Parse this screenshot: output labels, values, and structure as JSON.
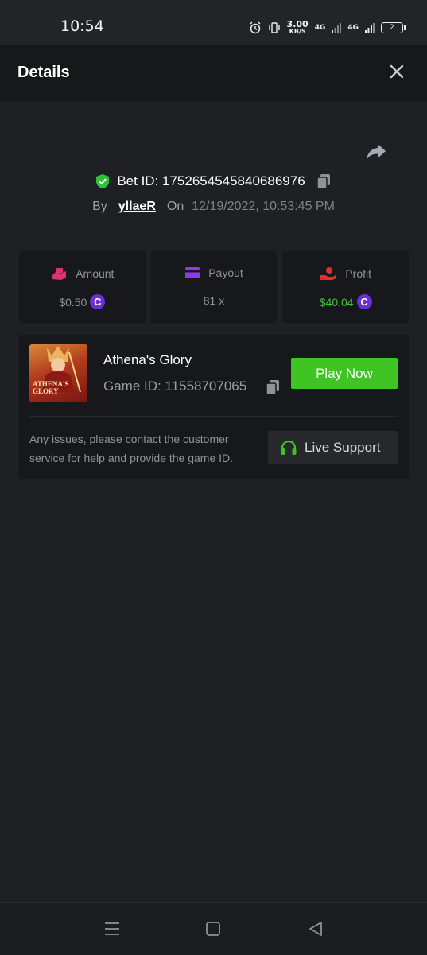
{
  "status_bar": {
    "time": "10:54",
    "speed_value": "3.00",
    "speed_unit": "KB/S",
    "net1": "4G",
    "net2": "4G",
    "battery": "2"
  },
  "header": {
    "title": "Details"
  },
  "bet": {
    "id_label": "Bet ID: 1752654545840686976",
    "by_label": "By",
    "user": "yllaeR",
    "on_label": "On",
    "datetime": "12/19/2022, 10:53:45 PM"
  },
  "stats": [
    {
      "label": "Amount",
      "value": "$0.50",
      "icon": "wallet-hand-icon"
    },
    {
      "label": "Payout",
      "value": "81 x",
      "icon": "card-icon"
    },
    {
      "label": "Profit",
      "value": "$40.04",
      "icon": "money-hand-icon"
    }
  ],
  "game": {
    "name": "Athena's Glory",
    "id_label": "Game ID: 11558707065",
    "play_label": "Play Now",
    "thumb_text_line1": "ATHENA'S",
    "thumb_text_line2": "GLORY"
  },
  "support": {
    "text": "Any issues, please contact the customer service for help and provide the game ID.",
    "button_label": "Live Support"
  },
  "colors": {
    "accent_green": "#3ec524",
    "coin_purple": "#6a2fd6",
    "amount_pink": "#e0336e",
    "payout_purple": "#8a3cf0",
    "profit_red": "#e0302e"
  }
}
